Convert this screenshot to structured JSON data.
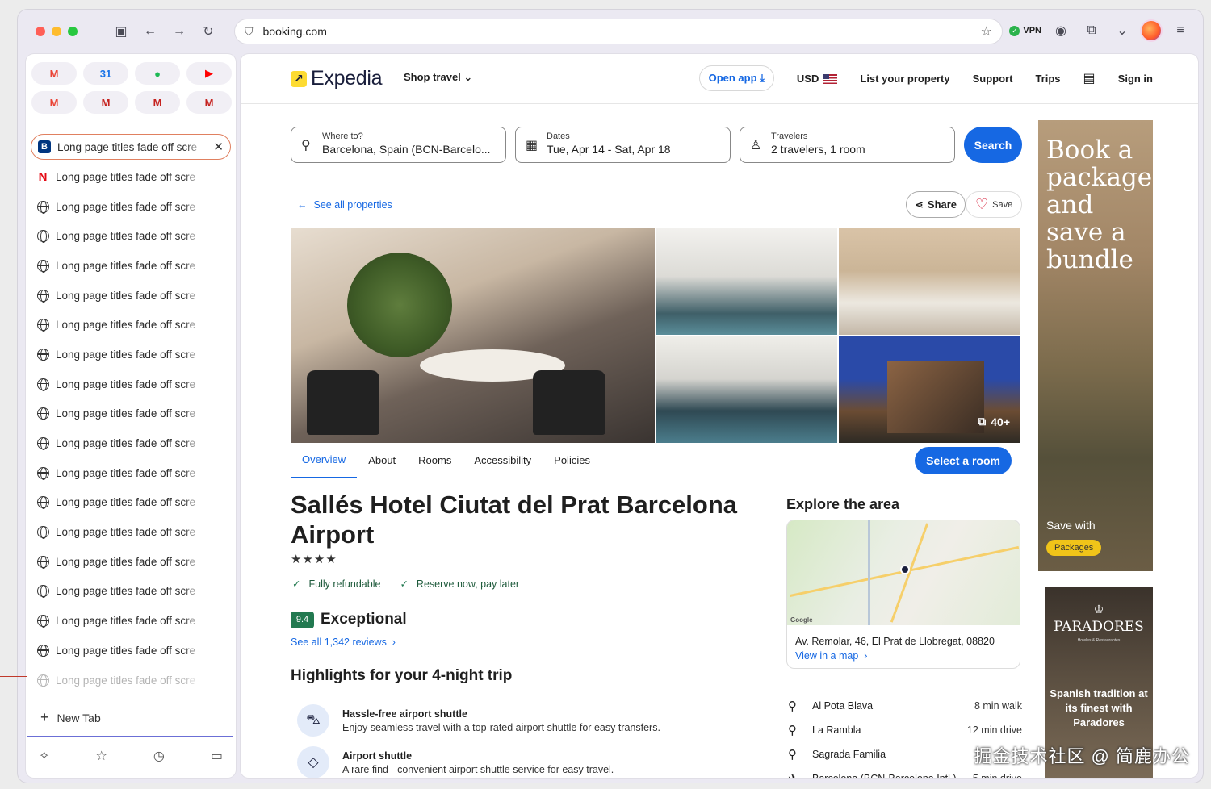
{
  "browser": {
    "url": "booking.com",
    "vpn_label": "VPN",
    "traffic_colors": [
      "#ff5f57",
      "#febc2e",
      "#28c840"
    ]
  },
  "sidebar": {
    "pinned": [
      {
        "icon": "gmail-icon",
        "glyph": "M",
        "color": "#ea4335"
      },
      {
        "icon": "calendar-icon",
        "glyph": "31",
        "color": "#1a73e8"
      },
      {
        "icon": "spotify-icon",
        "glyph": "●",
        "color": "#1db954"
      },
      {
        "icon": "youtube-icon",
        "glyph": "▶",
        "color": "#ff0000"
      },
      {
        "icon": "gmail-icon",
        "glyph": "M",
        "color": "#ea4335"
      },
      {
        "icon": "gmail-icon",
        "glyph": "M",
        "color": "#c5221f"
      },
      {
        "icon": "gmail-icon",
        "glyph": "M",
        "color": "#c5221f"
      },
      {
        "icon": "gmail-icon",
        "glyph": "M",
        "color": "#c5221f"
      }
    ],
    "tab_title": "Long page titles fade off scre",
    "new_tab": "New Tab"
  },
  "header": {
    "logo": "Expedia",
    "shop_travel": "Shop travel",
    "open_app": "Open app",
    "currency": "USD",
    "list_property": "List your property",
    "support": "Support",
    "trips": "Trips",
    "sign_in": "Sign in"
  },
  "search": {
    "where_label": "Where to?",
    "where_value": "Barcelona, Spain (BCN-Barcelo...",
    "dates_label": "Dates",
    "dates_value": "Tue, Apr 14 - Sat, Apr 18",
    "travelers_label": "Travelers",
    "travelers_value": "2 travelers, 1 room",
    "button": "Search"
  },
  "property": {
    "back_link": "See all properties",
    "share": "Share",
    "save": "Save",
    "photo_count": "40+",
    "tabs": [
      "Overview",
      "About",
      "Rooms",
      "Accessibility",
      "Policies"
    ],
    "select_room": "Select a room",
    "title": "Sallés Hotel Ciutat del Prat Barcelona Airport",
    "stars": "★★★★",
    "features": [
      "Fully refundable",
      "Reserve now, pay later"
    ],
    "score": "9.4",
    "rating_word": "Exceptional",
    "reviews_link": "See all 1,342 reviews",
    "highlights_title": "Highlights for your 4-night trip",
    "highlights": [
      {
        "title": "Hassle-free airport shuttle",
        "desc": "Enjoy seamless travel with a top-rated airport shuttle for easy transfers."
      },
      {
        "title": "Airport shuttle",
        "desc": "A rare find - convenient airport shuttle service for easy travel."
      }
    ]
  },
  "explore": {
    "title": "Explore the area",
    "address": "Av. Remolar, 46, El Prat de Llobregat, 08820",
    "view_map": "View in a map",
    "map_credit": "Google",
    "places": [
      {
        "name": "Al Pota Blava",
        "dist": "8 min walk"
      },
      {
        "name": "La Rambla",
        "dist": "12 min drive"
      },
      {
        "name": "Sagrada Familia",
        "dist": ""
      },
      {
        "name": "Barcelona (BCN-Barcelona Intl.)",
        "dist": "5 min drive"
      }
    ]
  },
  "ads": {
    "ad1_text": "Book a package and save a bundle",
    "ad1_save": "Save with",
    "ad1_button": "Packages",
    "ad2_brand": "PARADORES",
    "ad2_sub": "Hoteles & Restaurantes",
    "ad2_tagline": "Spanish tradition at its finest with Paradores"
  },
  "watermark": "掘金技术社区 @ 简鹿办公"
}
